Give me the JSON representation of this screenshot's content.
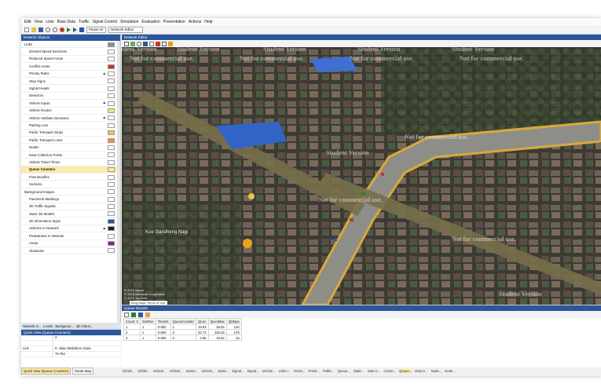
{
  "menu": [
    "Edit",
    "View",
    "Lists",
    "Base Data",
    "Traffic",
    "Signal Control",
    "Simulation",
    "Evaluation",
    "Presentation",
    "Actions",
    "Help"
  ],
  "toolbar": {
    "pause_label": "Pause at:",
    "mode_label": "Network Editor"
  },
  "objects_panel": {
    "title": "Network Objects",
    "items": [
      {
        "label": "Links",
        "group": true,
        "swatch": "#8c8c8c"
      },
      {
        "label": "Desired Speed Decisions",
        "swatch": ""
      },
      {
        "label": "Reduced Speed Areas",
        "swatch": ""
      },
      {
        "label": "Conflict Areas",
        "swatch": "#c0392b"
      },
      {
        "label": "Priority Rules",
        "swatch": "",
        "pin": true
      },
      {
        "label": "Stop Signs",
        "swatch": ""
      },
      {
        "label": "Signal Heads",
        "swatch": ""
      },
      {
        "label": "Detectors",
        "swatch": "#ffffff"
      },
      {
        "label": "Vehicle Inputs",
        "swatch": "",
        "pin": true
      },
      {
        "label": "Vehicle Routes",
        "swatch": "#e8e87a"
      },
      {
        "label": "Vehicle Attribute Decisions",
        "swatch": "",
        "pin": true
      },
      {
        "label": "Parking Lots",
        "swatch": "#ffffff"
      },
      {
        "label": "Public Transport Stops",
        "swatch": "#f0c04a"
      },
      {
        "label": "Public Transport Lines",
        "swatch": "#f28a3c"
      },
      {
        "label": "Nodes",
        "swatch": "#ffffff"
      },
      {
        "label": "Data Collection Points",
        "swatch": ""
      },
      {
        "label": "Vehicle Travel Times",
        "swatch": ""
      },
      {
        "label": "Queue Counters",
        "swatch": "",
        "selected": true
      },
      {
        "label": "Flow Bundles",
        "swatch": ""
      },
      {
        "label": "Sections",
        "swatch": "#ffffff"
      },
      {
        "label": "Background Images",
        "group": true,
        "swatch": ""
      },
      {
        "label": "Pavement Markings",
        "swatch": ""
      },
      {
        "label": "3D Traffic Signals",
        "swatch": ""
      },
      {
        "label": "Static 3D Models",
        "swatch": ""
      },
      {
        "label": "3D Information Signs",
        "swatch": "#2b579a"
      },
      {
        "label": "Vehicles In Network",
        "swatch": "#222222",
        "pin": true
      },
      {
        "label": "Pedestrians In Network",
        "swatch": ""
      },
      {
        "label": "Areas",
        "swatch": "#7a2b8c"
      },
      {
        "label": "Obstacles",
        "swatch": ""
      }
    ]
  },
  "left_tabs": [
    "Network O...",
    "Levels",
    "Backgroun...",
    "3D inform..."
  ],
  "quick_view": {
    "title": "Quick View (Queue Counters)",
    "rows": [
      {
        "k": "",
        "v": "3"
      },
      {
        "k": "",
        "v": ""
      },
      {
        "k": "Link",
        "v": "6: Jalan Malioboro Utara"
      },
      {
        "k": "",
        "v": "76.762"
      }
    ],
    "tabs": [
      "Quick View (Queue Counters)",
      "Smart Map"
    ]
  },
  "editor": {
    "title": "Network Editor",
    "watermark_a": "Student Version",
    "watermark_b": "Not for commercial use.",
    "street_label": "Kue Gandheng Nagi",
    "copyright_1": "© 2023 Maxar",
    "copyright_2": "© 2023 Microsoft Corporation",
    "copyright_3": "© 2023 TomTom",
    "maps_link": "Bing Maps Terms of Use"
  },
  "queue_results": {
    "title": "Queue Results",
    "columns": [
      "Count: 3",
      "SimRun",
      "TimeInt",
      "QueueCounter",
      "QLen",
      "QLenMax",
      "QStops"
    ],
    "rows": [
      [
        "1",
        "1",
        "0-600",
        "1",
        "19.93",
        "38.02",
        "140"
      ],
      [
        "2",
        "1",
        "0-600",
        "2",
        "32.72",
        "103.26",
        "178"
      ],
      [
        "3",
        "1",
        "0-600",
        "3",
        "3.86",
        "15.62",
        "15"
      ]
    ]
  },
  "bottom_tabs": [
    "2D/3D...",
    "2D/3D...",
    "Vehicle...",
    "Vehicle...",
    "Desire...",
    "Vehicle...",
    "Static...",
    "Signal...",
    "Signal...",
    "Vehicle...",
    "Links /...",
    "Drivin...",
    "Priorit...",
    "Public...",
    "Queue...",
    "Static...",
    "Data C...",
    "Camer...",
    "Queue...",
    "Data C...",
    "Node...",
    "Node..."
  ],
  "active_bottom_tab": 18,
  "colors": {
    "panel_title": "#2b579a",
    "selected": "#fde9a9"
  }
}
